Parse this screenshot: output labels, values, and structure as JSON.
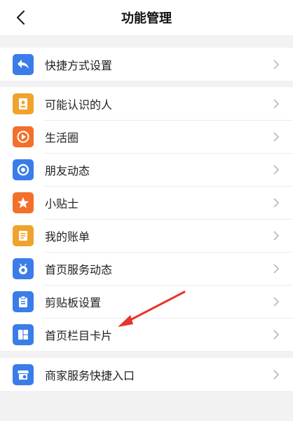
{
  "header": {
    "title": "功能管理",
    "back_icon": "chevron-left-icon"
  },
  "groups": [
    {
      "items": [
        {
          "label": "快捷方式设置",
          "icon": "share-back-icon",
          "color": "#3b7de8"
        }
      ]
    },
    {
      "items": [
        {
          "label": "可能认识的人",
          "icon": "contacts-icon",
          "color": "#f0a32c"
        },
        {
          "label": "生活圈",
          "icon": "play-circle-icon",
          "color": "#f2702b"
        },
        {
          "label": "朋友动态",
          "icon": "aperture-icon",
          "color": "#3b7de8"
        },
        {
          "label": "小贴士",
          "icon": "star-tip-icon",
          "color": "#f2702b"
        },
        {
          "label": "我的账单",
          "icon": "bill-icon",
          "color": "#f0a32c"
        },
        {
          "label": "首页服务动态",
          "icon": "robot-icon",
          "color": "#3b7de8"
        },
        {
          "label": "剪贴板设置",
          "icon": "clipboard-icon",
          "color": "#3b7de8"
        },
        {
          "label": "首页栏目卡片",
          "icon": "card-layout-icon",
          "color": "#3b7de8"
        }
      ]
    },
    {
      "items": [
        {
          "label": "商家服务快捷入口",
          "icon": "store-icon",
          "color": "#3b7de8"
        }
      ]
    }
  ],
  "annotation_color": "#e8352a"
}
